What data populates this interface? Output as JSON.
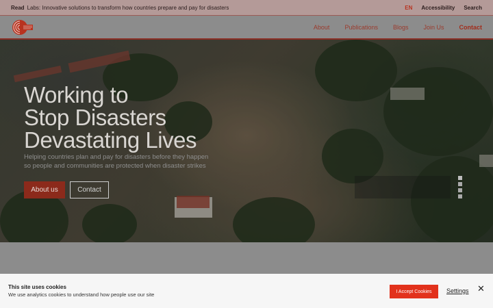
{
  "topbar": {
    "read_label": "Read",
    "announcement": "Labs: Innovative solutions to transform how countries prepare and pay for disasters",
    "lang": "EN",
    "accessibility": "Accessibility",
    "search": "Search"
  },
  "nav": {
    "items": [
      "About",
      "Publications",
      "Blogs",
      "Join Us",
      "Contact"
    ]
  },
  "hero": {
    "title_lines": [
      "Working to",
      "Stop Disasters",
      "Devastating Lives"
    ],
    "subtitle": "Helping countries plan and pay for disasters before they happen so people and communities are protected when disaster strikes",
    "btn_primary": "About us",
    "btn_secondary": "Contact"
  },
  "cookie": {
    "title": "This site uses cookies",
    "body": "We use analytics cookies to understand how people use our site",
    "accept": "I Accept Cookies",
    "settings": "Settings",
    "close": "✕"
  },
  "colors": {
    "brand_red": "#e2321c",
    "topbar_bg": "#b49a98"
  }
}
